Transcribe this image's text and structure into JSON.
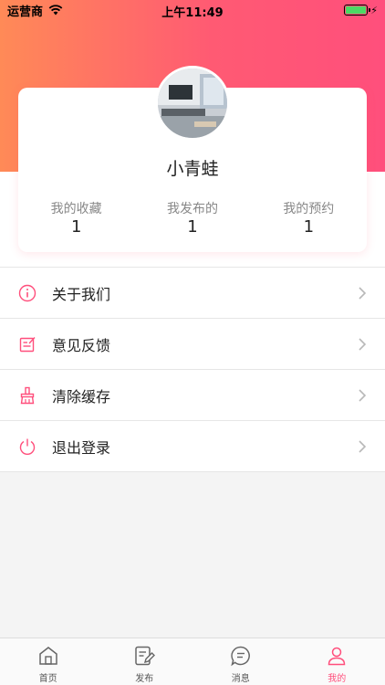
{
  "status_bar": {
    "carrier": "运营商",
    "time": "上午11:49"
  },
  "profile": {
    "name": "小青蛙",
    "stats": [
      {
        "label": "我的收藏",
        "value": "1"
      },
      {
        "label": "我发布的",
        "value": "1"
      },
      {
        "label": "我的预约",
        "value": "1"
      }
    ]
  },
  "menu": {
    "items": [
      {
        "label": "关于我们",
        "icon": "info-icon"
      },
      {
        "label": "意见反馈",
        "icon": "feedback-icon"
      },
      {
        "label": "清除缓存",
        "icon": "clear-cache-icon"
      },
      {
        "label": "退出登录",
        "icon": "power-icon"
      }
    ]
  },
  "tabbar": {
    "tabs": [
      {
        "label": "首页",
        "icon": "home-icon"
      },
      {
        "label": "发布",
        "icon": "publish-icon"
      },
      {
        "label": "消息",
        "icon": "message-icon"
      },
      {
        "label": "我的",
        "icon": "profile-icon"
      }
    ],
    "active_index": 3
  },
  "colors": {
    "accent": "#ff4f7c",
    "gradient_start": "#ff8a57",
    "gradient_end": "#ff4f7c",
    "battery": "#4cd964"
  }
}
